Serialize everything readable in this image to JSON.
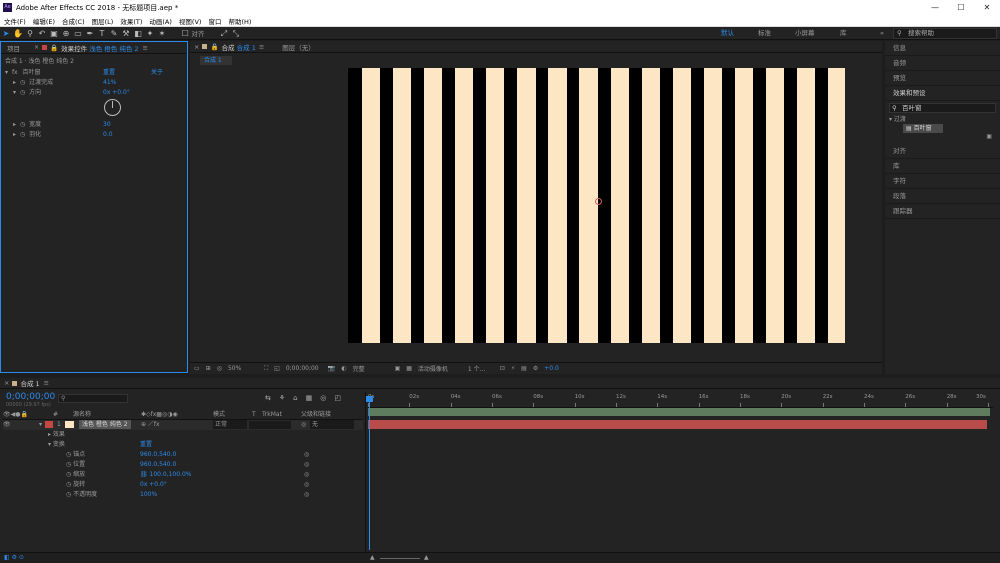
{
  "window": {
    "title": "Adobe After Effects CC 2018 - 无标题项目.aep *",
    "app_badge": "Ae",
    "min": "—",
    "max": "☐",
    "close": "✕"
  },
  "menu": [
    "文件(F)",
    "编辑(E)",
    "合成(C)",
    "图层(L)",
    "效果(T)",
    "动画(A)",
    "视图(V)",
    "窗口",
    "帮助(H)"
  ],
  "toolbar": {
    "align_label": "对齐",
    "workspaces": [
      {
        "label": "默认",
        "active": true
      },
      {
        "label": "标准",
        "active": false
      },
      {
        "label": "小屏幕",
        "active": false
      },
      {
        "label": "库",
        "active": false
      }
    ],
    "search_placeholder": "搜索帮助",
    "overflow": "»"
  },
  "left_panel": {
    "tab_project": "项目",
    "tab_effects_prefix": "效果控件",
    "tab_effects_layer": "浅色 橙色 纯色 2",
    "menu_glyph": "≡",
    "breadcrumb": "合成 1 · 浅色 橙色 纯色 2",
    "effect": {
      "name": "百叶窗",
      "fx": "fx",
      "reset": "重置",
      "about": "关于"
    },
    "props": [
      {
        "name": "过渡完成",
        "value": "41%"
      },
      {
        "name": "方向",
        "value": "0x +0.0°"
      },
      {
        "name": "宽度",
        "value": "30"
      },
      {
        "name": "羽化",
        "value": "0.0"
      }
    ]
  },
  "viewer": {
    "tab_comp": "合成",
    "tab_comp_name": "合成 1",
    "tab_layer": "图层（无）",
    "comp_chip": "合成 1",
    "bottom": {
      "zoom": "50%",
      "timecode": "0;00;00;00",
      "quality": "完整",
      "camera": "活动摄像机",
      "views": "1 个...",
      "exposure": "+0.0"
    }
  },
  "right_panel": {
    "items_top": [
      "信息",
      "音频",
      "预览",
      "效果和预设"
    ],
    "search_value": "百叶窗",
    "group": "过渡",
    "result": "百叶窗",
    "items_bottom": [
      "对齐",
      "库",
      "字符",
      "段落",
      "跟踪器"
    ]
  },
  "timeline": {
    "tab": "合成 1",
    "timecode": "0;00;00;00",
    "frame_info": "00000 (29.97 fps)",
    "cols": {
      "num": "#",
      "name": "源名称",
      "mode": "模式",
      "t": "T",
      "trkmat": "TrkMat",
      "parent": "父级和链接"
    },
    "layer": {
      "num": "1",
      "name": "浅色 橙色 纯色 2",
      "mode": "正常",
      "parent": "无",
      "parent_glyph": "◎"
    },
    "sub": [
      {
        "name": "效果",
        "value": ""
      },
      {
        "name": "变换",
        "value": "重置"
      },
      {
        "name": "锚点",
        "value": "960.0,540.0"
      },
      {
        "name": "位置",
        "value": "960.0,540.0"
      },
      {
        "name": "缩放",
        "value": "100.0,100.0%"
      },
      {
        "name": "旋转",
        "value": "0x +0.0°"
      },
      {
        "name": "不透明度",
        "value": "100%"
      }
    ],
    "ruler": [
      "0s",
      "02s",
      "04s",
      "06s",
      "08s",
      "10s",
      "12s",
      "14s",
      "16s",
      "18s",
      "20s",
      "22s",
      "24s",
      "26s",
      "28s",
      "30s"
    ]
  },
  "colors": {
    "accent": "#2d8ceb",
    "stripe": "#fde6c4",
    "layer_bar": "#b94b4b",
    "work_area": "#5f7c5f",
    "label": "#c64545"
  }
}
